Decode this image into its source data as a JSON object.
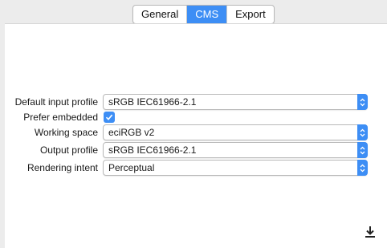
{
  "tabs": [
    {
      "label": "General",
      "active": false
    },
    {
      "label": "CMS",
      "active": true
    },
    {
      "label": "Export",
      "active": false
    }
  ],
  "cms": {
    "default_input_profile": {
      "label": "Default input profile",
      "value": "sRGB IEC61966-2.1"
    },
    "prefer_embedded": {
      "label": "Prefer embedded",
      "checked": true
    },
    "working_space": {
      "label": "Working space",
      "value": "eciRGB v2"
    },
    "output_profile": {
      "label": "Output profile",
      "value": "sRGB IEC61966-2.1"
    },
    "rendering_intent": {
      "label": "Rendering intent",
      "value": "Perceptual"
    }
  },
  "icons": {
    "select_arrows": "up-down-chevron-icon",
    "checkbox": "checkmark-icon",
    "download": "download-icon"
  },
  "colors": {
    "accent": "#3d8ef5",
    "window_bg": "#ececec",
    "panel_bg": "#ffffff"
  }
}
